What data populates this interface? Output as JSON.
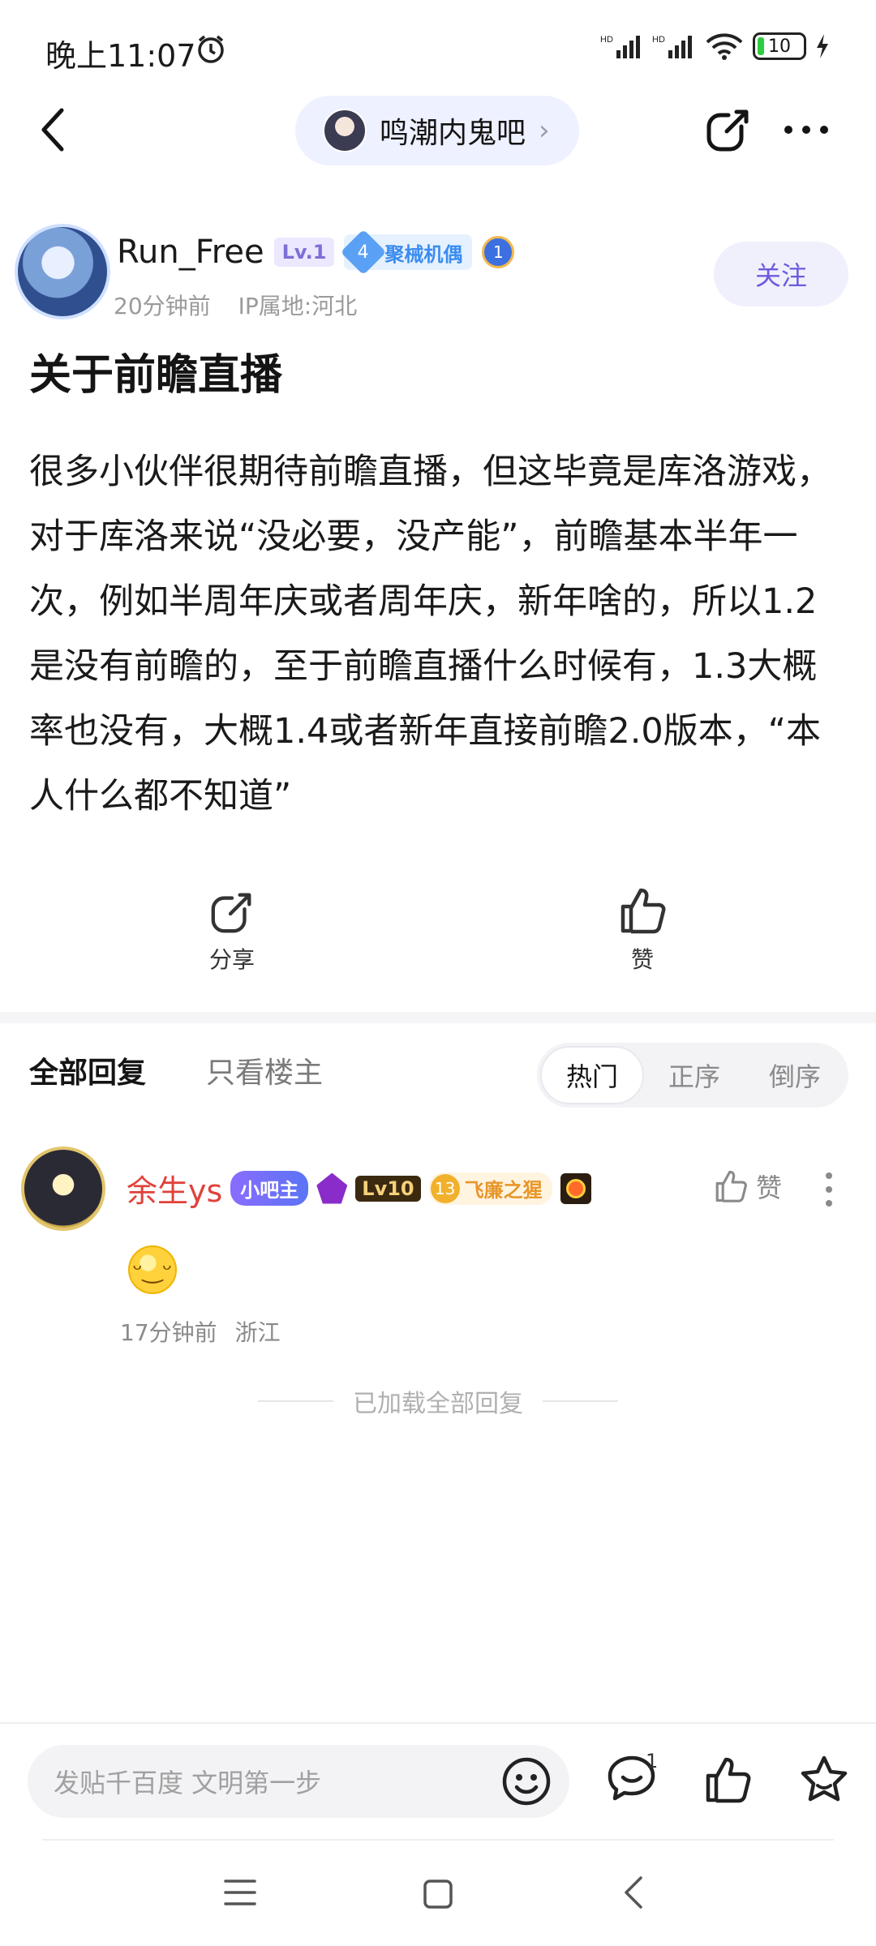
{
  "status_bar": {
    "time": "晚上11:07",
    "battery": "10"
  },
  "header": {
    "forum_name": "鸣潮内鬼吧"
  },
  "post": {
    "author": {
      "name": "Run_Free",
      "level": "Lv.1",
      "tag_number": "4",
      "tag_label": "聚械机偶",
      "medal_number": "1",
      "time_ago": "20分钟前",
      "ip_location": "IP属地:河北"
    },
    "follow_label": "关注",
    "title": "关于前瞻直播",
    "body": "很多小伙伴很期待前瞻直播，但这毕竟是库洛游戏，对于库洛来说“没必要，没产能”，前瞻基本半年一次，例如半周年庆或者周年庆，新年啥的，所以1.2是没有前瞻的，至于前瞻直播什么时候有，1.3大概率也没有，大概1.4或者新年直接前瞻2.0版本，“本人什么都不知道”",
    "share_label": "分享",
    "like_label": "赞"
  },
  "replies_section": {
    "tab_all": "全部回复",
    "tab_host_only": "只看楼主",
    "sort_options": [
      "热门",
      "正序",
      "倒序"
    ],
    "active_sort": "热门",
    "replies": [
      {
        "name": "余生ys",
        "owner_badge": "小吧主",
        "level": "Lv10",
        "honor_number": "13",
        "honor_label": "飞廉之猩",
        "like_label": "赞",
        "time_ago": "17分钟前",
        "location": "浙江"
      }
    ],
    "loaded_all_text": "已加载全部回复"
  },
  "bottom_bar": {
    "input_placeholder": "发贴千百度 文明第一步",
    "reply_count": "1"
  },
  "icons": [
    "back-arrow-icon",
    "share-icon",
    "more-icon",
    "thumb-up-icon",
    "emoji-icon",
    "comment-icon",
    "star-icon",
    "menu-icon",
    "home-icon",
    "nav-back-icon"
  ],
  "colors": {
    "accent": "#6b5ce0",
    "username_red": "#e0413a",
    "pill_bg": "#eef1ff"
  }
}
